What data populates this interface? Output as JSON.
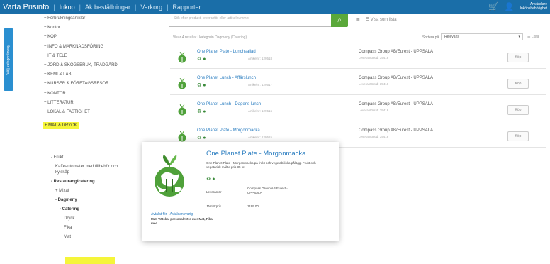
{
  "topbar": {
    "brand": "Varta Prisinfo",
    "nav": [
      "Inkop",
      "Ak beställningar",
      "Varkorg",
      "Rapporter"
    ],
    "user_info": [
      "Användare",
      "Inköpsbehörighet"
    ],
    "colors": {
      "bar": "#1a6ea8"
    }
  },
  "side_tab": {
    "label": "Välj kategori/meny"
  },
  "tree": {
    "items": [
      "+ Förbrukningsartiklar",
      "+ Kontor",
      "+ KOP",
      "+ INFO & MARKNADSFÖRING",
      "+ IT & TELE",
      "+ JORD & SKOGSBRUK, TRÄDGÅRD",
      "+ KEMI & LAB",
      "+ KURSER & FÖRETAGSRESOR",
      "+ KONTOR",
      "+ LITTERATUR",
      "+ LOKAL & FASTIGHET"
    ],
    "highlight": "+ MAT & DRYCK"
  },
  "tree2": [
    {
      "text": "- Frukt",
      "indent": 0,
      "bold": false
    },
    {
      "text": "Kaffeautomater med tillbehör och",
      "indent": 6,
      "bold": false
    },
    {
      "text": "kylskåp",
      "indent": 6,
      "bold": false
    },
    {
      "text": "- Restaurang/catering",
      "indent": 0,
      "bold": true
    },
    {
      "text": "+ Mixat",
      "indent": 6,
      "bold": false
    },
    {
      "text": "- Dagmeny",
      "indent": 6,
      "bold": true
    },
    {
      "text": "- Catering",
      "indent": 12,
      "bold": true
    },
    {
      "text": "Dryck",
      "indent": 18,
      "bold": false
    },
    {
      "text": "Fika",
      "indent": 18,
      "bold": false
    },
    {
      "text": "Mat",
      "indent": 18,
      "bold": false
    }
  ],
  "search": {
    "placeholder": "Sök efter produkt, leverantör eller artikelnummer",
    "button": "⌕"
  },
  "tools": {
    "grid": "▦",
    "list": "☰ Visa som lista"
  },
  "results": {
    "info": "Visar 4 resultat i kategorin Dagmeny (Catering)",
    "sort_label": "Sortera på",
    "sort_value": "Relevans",
    "view": "☰ Lista"
  },
  "rows": [
    {
      "name": "One Planet Plate - Lunchsallad",
      "code": "Artikelnr: 129518",
      "supplier": "Compass Group AB/Eurest - UPPSALA",
      "delivery": "Leverantörsid: 35418",
      "button": "Köp"
    },
    {
      "name": "One Planet Lunch - Affärslunch",
      "code": "Artikelnr: 129517",
      "supplier": "Compass Group AB/Eurest - UPPSALA",
      "delivery": "Leverantörsid: 35418",
      "button": "Köp"
    },
    {
      "name": "One Planet Lunch - Dagens lunch",
      "code": "Artikelnr: 129516",
      "supplier": "Compass Group AB/Eurest - UPPSALA",
      "delivery": "Leverantörsid: 35418",
      "button": "Köp"
    },
    {
      "name": "One Planet Plate - Morgonmacka",
      "code": "Artikelnr: 129515",
      "supplier": "Compass Group AB/Eurest - UPPSALA",
      "delivery": "Leverantörsid: 35418",
      "button": "Köp"
    }
  ],
  "popup": {
    "title": "One Planet Plate - Morgonmacka",
    "description": "One Planet Plate - Morgonmacka på frukt och vegetabiliska pålägg. Frukt och vegetarisk måltid pris 35 kr.",
    "icons": "♻ ●",
    "labels": {
      "supplier": "Leverantör",
      "price": "Jämförpris"
    },
    "values": {
      "supplier": "Compass Group AB/Eurest - UPPSALA",
      "price": "1199.00"
    },
    "link": "Avtalat för - Avtalsansvarig",
    "text": "Mat, Vätska, personalmöte mer Mat, Fika med"
  }
}
